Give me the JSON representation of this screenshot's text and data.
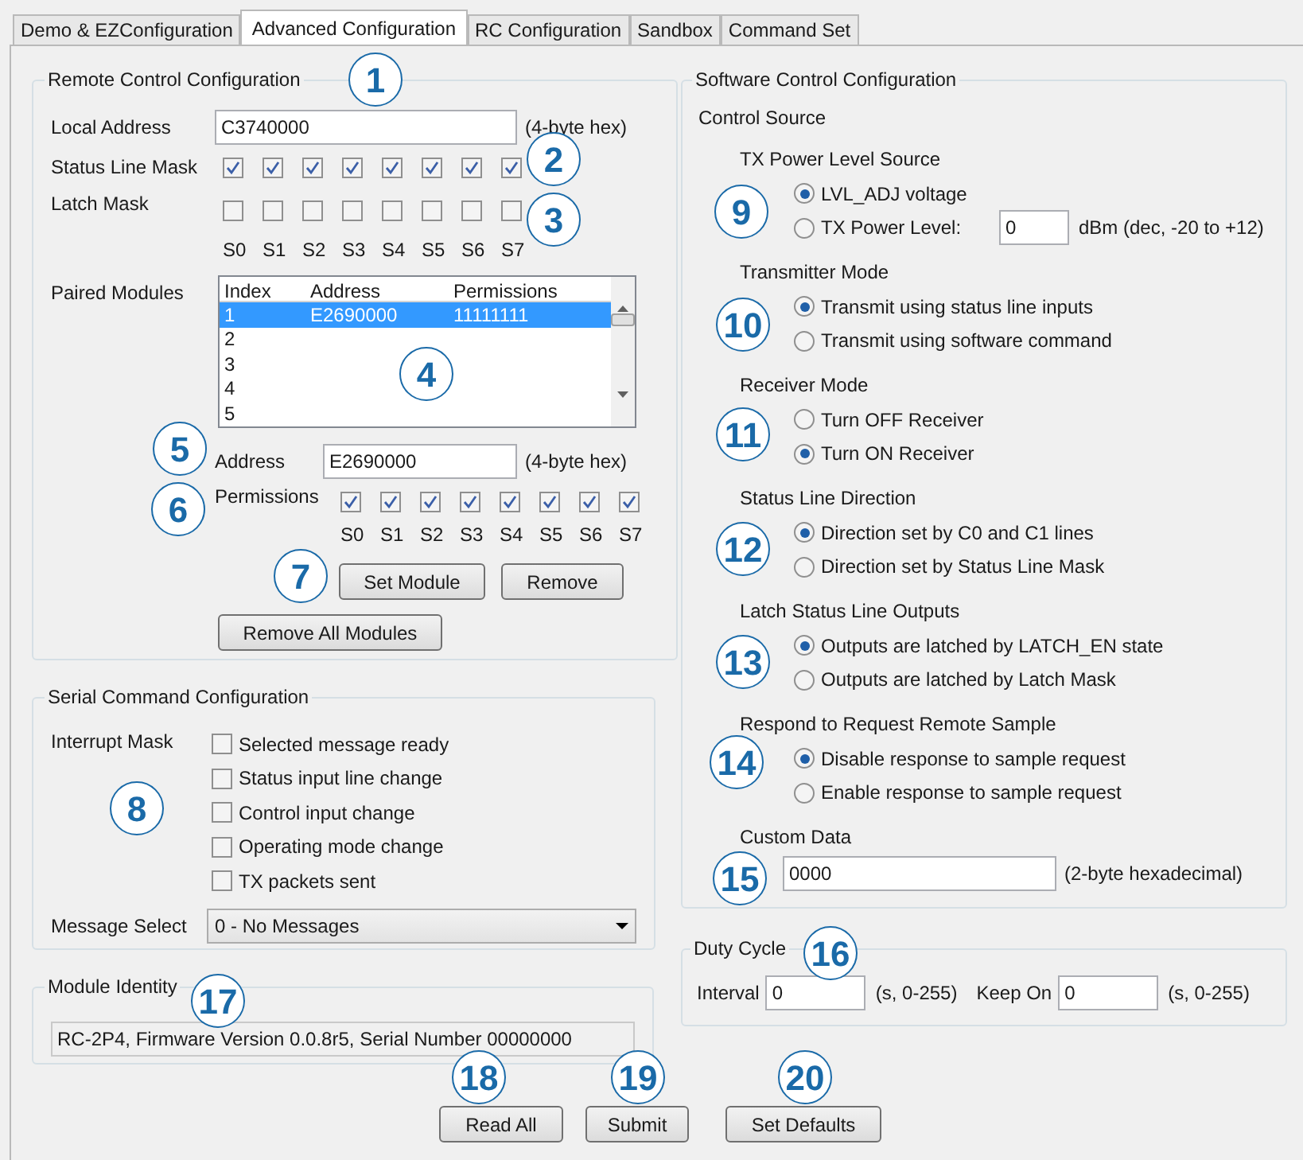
{
  "tabs": [
    {
      "label": "Demo & EZConfiguration",
      "selected": false
    },
    {
      "label": "Advanced Configuration",
      "selected": true
    },
    {
      "label": "RC Configuration",
      "selected": false
    },
    {
      "label": "Sandbox",
      "selected": false
    },
    {
      "label": "Command Set",
      "selected": false
    }
  ],
  "remote_control": {
    "title": "Remote Control Configuration",
    "local_address": {
      "label": "Local Address",
      "value": "C3740000",
      "hint": "(4-byte hex)"
    },
    "status_line_mask": {
      "label": "Status Line Mask",
      "bits": [
        {
          "checked": true
        },
        {
          "checked": true
        },
        {
          "checked": true
        },
        {
          "checked": true
        },
        {
          "checked": true
        },
        {
          "checked": true
        },
        {
          "checked": true
        },
        {
          "checked": true
        }
      ]
    },
    "latch_mask": {
      "label": "Latch Mask",
      "bits": [
        {
          "checked": false
        },
        {
          "checked": false
        },
        {
          "checked": false
        },
        {
          "checked": false
        },
        {
          "checked": false
        },
        {
          "checked": false
        },
        {
          "checked": false
        },
        {
          "checked": false
        }
      ],
      "bit_labels": [
        "S0",
        "S1",
        "S2",
        "S3",
        "S4",
        "S5",
        "S6",
        "S7"
      ]
    },
    "paired_modules": {
      "label": "Paired Modules",
      "columns": [
        "Index",
        "Address",
        "Permissions"
      ],
      "rows": [
        {
          "cells": [
            "1",
            "E2690000",
            "11111111"
          ],
          "selected": true
        },
        {
          "cells": [
            "2"
          ],
          "selected": false
        },
        {
          "cells": [
            "3"
          ],
          "selected": false
        },
        {
          "cells": [
            "4"
          ],
          "selected": false
        },
        {
          "cells": [
            "5"
          ],
          "selected": false
        }
      ]
    },
    "address": {
      "label": "Address",
      "value": "E2690000",
      "hint": "(4-byte hex)"
    },
    "permissions": {
      "label": "Permissions",
      "bits": [
        {
          "checked": true
        },
        {
          "checked": true
        },
        {
          "checked": true
        },
        {
          "checked": true
        },
        {
          "checked": true
        },
        {
          "checked": true
        },
        {
          "checked": true
        },
        {
          "checked": true
        }
      ],
      "bit_labels": [
        "S0",
        "S1",
        "S2",
        "S3",
        "S4",
        "S5",
        "S6",
        "S7"
      ]
    },
    "buttons": [
      "Set Module",
      "Remove"
    ],
    "remove_all": "Remove All Modules"
  },
  "serial_command": {
    "title": "Serial Command Configuration",
    "interrupt_mask_label": "Interrupt Mask",
    "interrupts": [
      {
        "label": "Selected message ready",
        "checked": false
      },
      {
        "label": "Status input line change",
        "checked": false
      },
      {
        "label": "Control input change",
        "checked": false
      },
      {
        "label": "Operating mode change",
        "checked": false
      },
      {
        "label": "TX packets sent",
        "checked": false
      }
    ],
    "message_select": {
      "label": "Message Select",
      "value": "0 - No Messages"
    }
  },
  "module_identity": {
    "title": "Module Identity",
    "value": "RC-2P4, Firmware Version 0.0.8r5, Serial Number 00000000"
  },
  "software_control": {
    "title": "Software Control Configuration",
    "subtitle": "Control Source",
    "sections": [
      {
        "title": "TX Power Level Source",
        "options": [
          {
            "label": "LVL_ADJ voltage",
            "selected": true
          },
          {
            "label": "TX Power Level:",
            "selected": false,
            "value": "0",
            "hint": "dBm (dec, -20 to +12)"
          }
        ]
      },
      {
        "title": "Transmitter Mode",
        "options": [
          {
            "label": "Transmit using status line inputs",
            "selected": true
          },
          {
            "label": "Transmit using software command",
            "selected": false
          }
        ]
      },
      {
        "title": "Receiver Mode",
        "options": [
          {
            "label": "Turn OFF Receiver",
            "selected": false
          },
          {
            "label": "Turn ON Receiver",
            "selected": true
          }
        ]
      },
      {
        "title": "Status Line Direction",
        "options": [
          {
            "label": "Direction set by C0 and C1 lines",
            "selected": true
          },
          {
            "label": "Direction set by Status Line Mask",
            "selected": false
          }
        ]
      },
      {
        "title": "Latch Status Line Outputs",
        "options": [
          {
            "label": "Outputs are latched by LATCH_EN state",
            "selected": true
          },
          {
            "label": "Outputs are latched by Latch Mask",
            "selected": false
          }
        ]
      },
      {
        "title": "Respond to Request Remote Sample",
        "options": [
          {
            "label": "Disable response to sample request",
            "selected": true
          },
          {
            "label": "Enable response to sample request",
            "selected": false
          }
        ]
      }
    ],
    "custom_data": {
      "title": "Custom Data",
      "value": "0000",
      "hint": "(2-byte hexadecimal)"
    }
  },
  "duty_cycle": {
    "title": "Duty Cycle",
    "interval": {
      "label": "Interval",
      "value": "0",
      "hint": "(s, 0-255)"
    },
    "keep_on": {
      "label": "Keep On",
      "value": "0",
      "hint": "(s, 0-255)"
    }
  },
  "buttons": [
    "Read All",
    "Submit",
    "Set Defaults"
  ],
  "callouts": [
    "1",
    "2",
    "3",
    "4",
    "5",
    "6",
    "7",
    "8",
    "9",
    "10",
    "11",
    "12",
    "13",
    "14",
    "15",
    "16",
    "17",
    "18",
    "19",
    "20"
  ]
}
